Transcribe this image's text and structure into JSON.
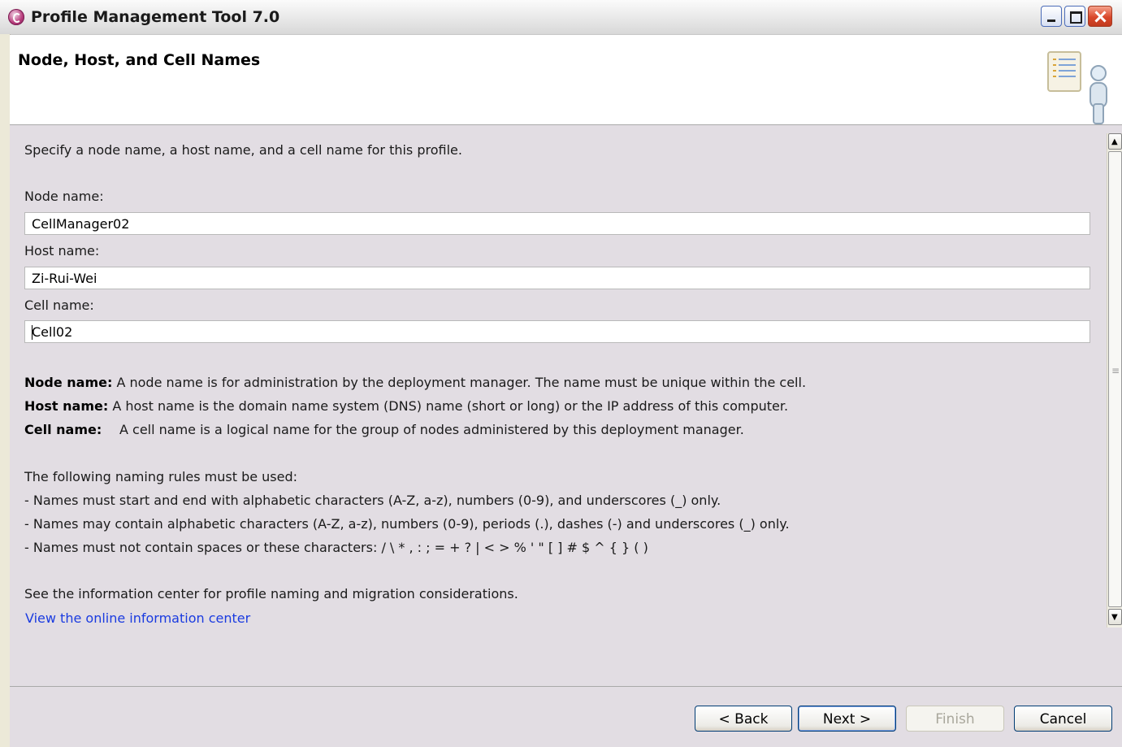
{
  "window": {
    "title": "Profile Management Tool 7.0"
  },
  "header": {
    "title": "Node, Host, and Cell Names"
  },
  "content": {
    "intro": "Specify a node name, a host name, and a cell name for this profile.",
    "fields": [
      {
        "label": "Node name:",
        "value": "CellManager02"
      },
      {
        "label": "Host name:",
        "value": "Zi-Rui-Wei"
      },
      {
        "label": "Cell name:",
        "value": "Cell02"
      }
    ],
    "descriptions": [
      {
        "term": "Node name:",
        "text": " A node name is for administration by the deployment manager. The name must be unique within the cell."
      },
      {
        "term": "Host name:",
        "text": " A host name is the domain name system (DNS) name (short or long) or the IP address of this computer."
      },
      {
        "term": "Cell name:",
        "text": "A cell name is a logical name for the group of nodes administered by this deployment manager."
      }
    ],
    "rules_heading": "The following naming rules must be used:",
    "rules": [
      "- Names must start and end with alphabetic characters (A-Z, a-z), numbers (0-9), and underscores (_) only.",
      "- Names may contain alphabetic characters (A-Z, a-z), numbers (0-9), periods (.), dashes (-) and underscores (_) only.",
      "- Names must not contain spaces or these characters: / \\ * , : ; = + ? | < >  % ' \" [ ] # $ ^ { } ( )"
    ],
    "info_text": "See the information center for profile naming and migration considerations.",
    "info_link": "View the online information center"
  },
  "footer": {
    "back_label": "< Back",
    "next_label": "Next >",
    "finish_label": "Finish",
    "cancel_label": "Cancel"
  },
  "colors": {
    "link": "#1A3BE0",
    "content_bg": "#E2DDE3",
    "header_bg": "#FFFFFF"
  }
}
